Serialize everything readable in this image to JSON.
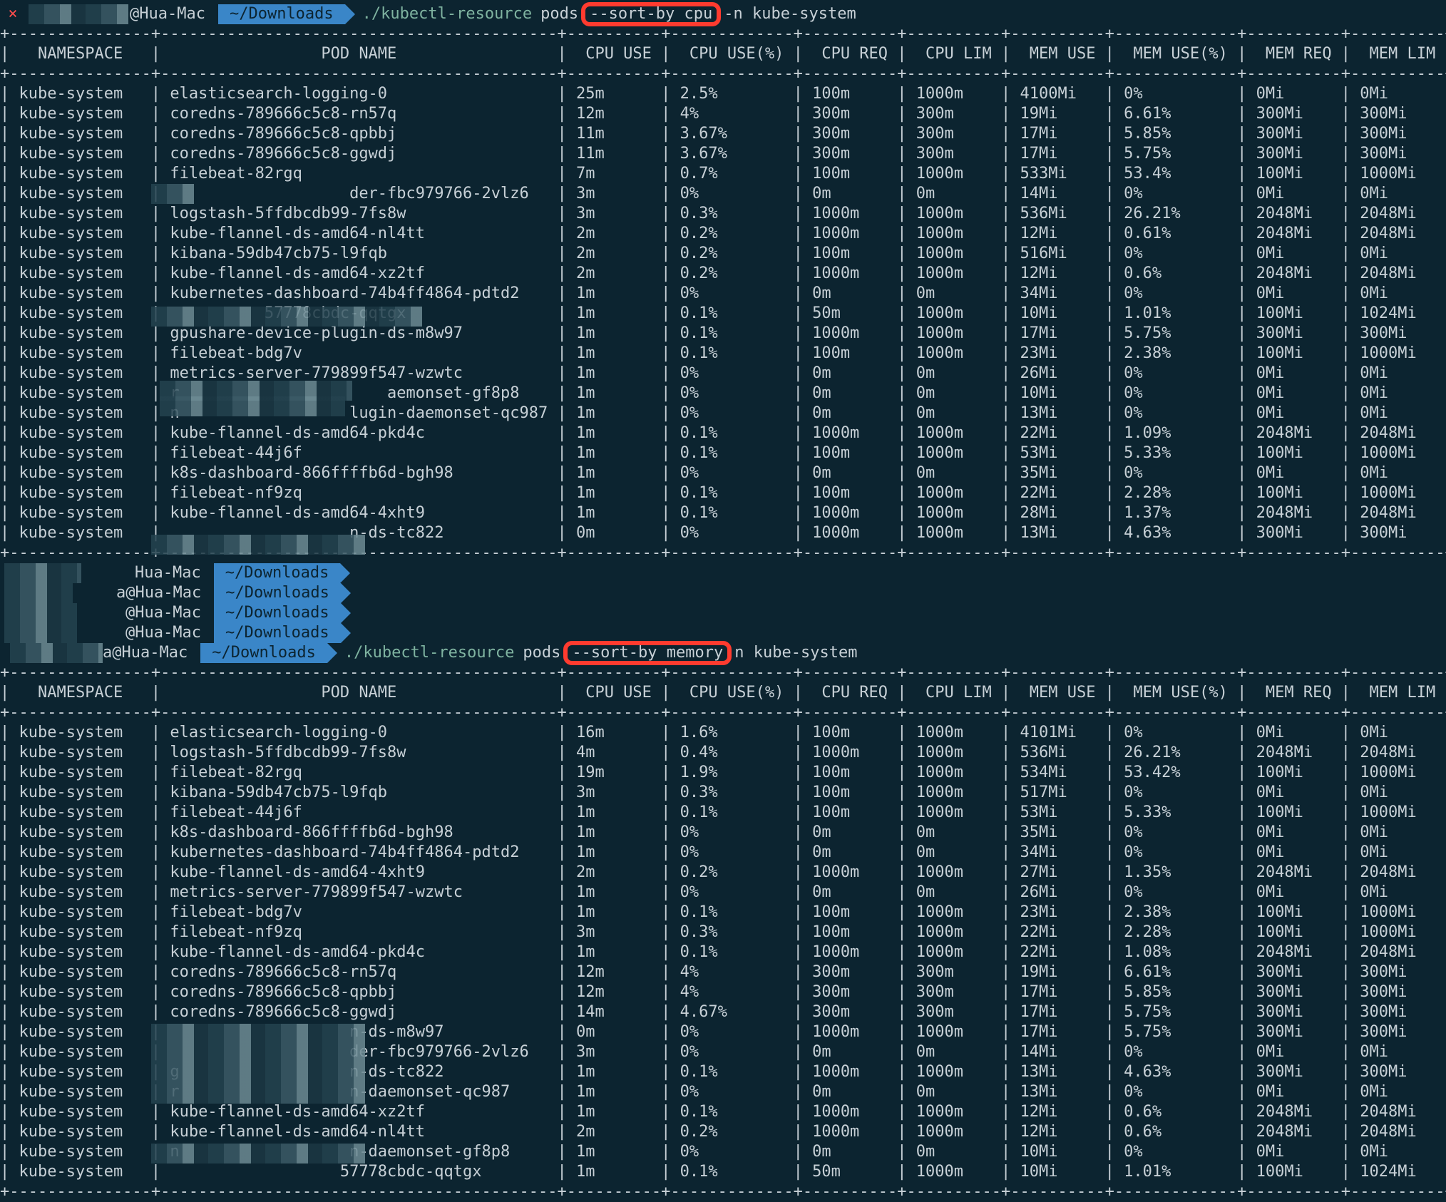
{
  "theme": {
    "background": "#0c2430",
    "path_segment": "#3a86c8",
    "highlight_box": "#ff3b2f",
    "error_mark": "#ff4d4d"
  },
  "prompt1": {
    "status_icon": "×",
    "user": "@Hua-Mac",
    "path": "~/Downloads",
    "command": "./kubectl-resource",
    "arg": "pods",
    "flag": "--sort-by cpu",
    "tail": "-n kube-system"
  },
  "columns": [
    "NAMESPACE",
    "POD NAME",
    "CPU USE",
    "CPU USE(%)",
    "CPU REQ",
    "CPU LIM",
    "MEM USE",
    "MEM USE(%)",
    "MEM REQ",
    "MEM LIM"
  ],
  "table1": [
    [
      "kube-system",
      "elasticsearch-logging-0",
      "25m",
      "2.5%",
      "100m",
      "1000m",
      "4100Mi",
      "0%",
      "0Mi",
      "0Mi"
    ],
    [
      "kube-system",
      "coredns-789666c5c8-rn57q",
      "12m",
      "4%",
      "300m",
      "300m",
      "19Mi",
      "6.61%",
      "300Mi",
      "300Mi"
    ],
    [
      "kube-system",
      "coredns-789666c5c8-qpbbj",
      "11m",
      "3.67%",
      "300m",
      "300m",
      "17Mi",
      "5.85%",
      "300Mi",
      "300Mi"
    ],
    [
      "kube-system",
      "coredns-789666c5c8-ggwdj",
      "11m",
      "3.67%",
      "300m",
      "300m",
      "17Mi",
      "5.75%",
      "300Mi",
      "300Mi"
    ],
    [
      "kube-system",
      "filebeat-82rgq",
      "7m",
      "0.7%",
      "100m",
      "1000m",
      "533Mi",
      "53.4%",
      "100Mi",
      "1000Mi"
    ],
    [
      "kube-system",
      "                   der-fbc979766-2vlz6",
      "3m",
      "0%",
      "0m",
      "0m",
      "14Mi",
      "0%",
      "0Mi",
      "0Mi"
    ],
    [
      "kube-system",
      "logstash-5ffdbcdb99-7fs8w",
      "3m",
      "0.3%",
      "1000m",
      "1000m",
      "536Mi",
      "26.21%",
      "2048Mi",
      "2048Mi"
    ],
    [
      "kube-system",
      "kube-flannel-ds-amd64-nl4tt",
      "2m",
      "0.2%",
      "1000m",
      "1000m",
      "12Mi",
      "0.61%",
      "2048Mi",
      "2048Mi"
    ],
    [
      "kube-system",
      "kibana-59db47cb75-l9fqb",
      "2m",
      "0.2%",
      "100m",
      "1000m",
      "516Mi",
      "0%",
      "0Mi",
      "0Mi"
    ],
    [
      "kube-system",
      "kube-flannel-ds-amd64-xz2tf",
      "2m",
      "0.2%",
      "1000m",
      "1000m",
      "12Mi",
      "0.6%",
      "2048Mi",
      "2048Mi"
    ],
    [
      "kube-system",
      "kubernetes-dashboard-74b4ff4864-pdtd2",
      "1m",
      "0%",
      "0m",
      "0m",
      "34Mi",
      "0%",
      "0Mi",
      "0Mi"
    ],
    [
      "kube-system",
      "          57778cbdc-qqtgx",
      "1m",
      "0.1%",
      "50m",
      "1000m",
      "10Mi",
      "1.01%",
      "100Mi",
      "1024Mi"
    ],
    [
      "kube-system",
      "gpushare-device-plugin-ds-m8w97",
      "1m",
      "0.1%",
      "1000m",
      "1000m",
      "17Mi",
      "5.75%",
      "300Mi",
      "300Mi"
    ],
    [
      "kube-system",
      "filebeat-bdg7v",
      "1m",
      "0.1%",
      "100m",
      "1000m",
      "23Mi",
      "2.38%",
      "100Mi",
      "1000Mi"
    ],
    [
      "kube-system",
      "metrics-server-779899f547-wzwtc",
      "1m",
      "0%",
      "0m",
      "0m",
      "26Mi",
      "0%",
      "0Mi",
      "0Mi"
    ],
    [
      "kube-system",
      "r                      aemonset-gf8p8",
      "1m",
      "0%",
      "0m",
      "0m",
      "10Mi",
      "0%",
      "0Mi",
      "0Mi"
    ],
    [
      "kube-system",
      "n                  lugin-daemonset-qc987",
      "1m",
      "0%",
      "0m",
      "0m",
      "13Mi",
      "0%",
      "0Mi",
      "0Mi"
    ],
    [
      "kube-system",
      "kube-flannel-ds-amd64-pkd4c",
      "1m",
      "0.1%",
      "1000m",
      "1000m",
      "22Mi",
      "1.09%",
      "2048Mi",
      "2048Mi"
    ],
    [
      "kube-system",
      "filebeat-44j6f",
      "1m",
      "0.1%",
      "100m",
      "1000m",
      "53Mi",
      "5.33%",
      "100Mi",
      "1000Mi"
    ],
    [
      "kube-system",
      "k8s-dashboard-866ffffb6d-bgh98",
      "1m",
      "0%",
      "0m",
      "0m",
      "35Mi",
      "0%",
      "0Mi",
      "0Mi"
    ],
    [
      "kube-system",
      "filebeat-nf9zq",
      "1m",
      "0.1%",
      "100m",
      "1000m",
      "22Mi",
      "2.28%",
      "100Mi",
      "1000Mi"
    ],
    [
      "kube-system",
      "kube-flannel-ds-amd64-4xht9",
      "1m",
      "0.1%",
      "1000m",
      "1000m",
      "28Mi",
      "1.37%",
      "2048Mi",
      "2048Mi"
    ],
    [
      "kube-system",
      "                   n-ds-tc822",
      "0m",
      "0%",
      "1000m",
      "1000m",
      "13Mi",
      "4.63%",
      "300Mi",
      "300Mi"
    ]
  ],
  "history": [
    {
      "user": "Hua-Mac",
      "path": "~/Downloads"
    },
    {
      "user": "a@Hua-Mac",
      "path": "~/Downloads"
    },
    {
      "user": "@Hua-Mac",
      "path": "~/Downloads"
    },
    {
      "user": "@Hua-Mac",
      "path": "~/Downloads"
    }
  ],
  "prompt2": {
    "user": "a@Hua-Mac",
    "path": "~/Downloads",
    "command": "./kubectl-resource",
    "arg": "pods",
    "flag": "--sort-by memory",
    "tail": "n kube-system"
  },
  "table2": [
    [
      "kube-system",
      "elasticsearch-logging-0",
      "16m",
      "1.6%",
      "100m",
      "1000m",
      "4101Mi",
      "0%",
      "0Mi",
      "0Mi"
    ],
    [
      "kube-system",
      "logstash-5ffdbcdb99-7fs8w",
      "4m",
      "0.4%",
      "1000m",
      "1000m",
      "536Mi",
      "26.21%",
      "2048Mi",
      "2048Mi"
    ],
    [
      "kube-system",
      "filebeat-82rgq",
      "19m",
      "1.9%",
      "100m",
      "1000m",
      "534Mi",
      "53.42%",
      "100Mi",
      "1000Mi"
    ],
    [
      "kube-system",
      "kibana-59db47cb75-l9fqb",
      "3m",
      "0.3%",
      "100m",
      "1000m",
      "517Mi",
      "0%",
      "0Mi",
      "0Mi"
    ],
    [
      "kube-system",
      "filebeat-44j6f",
      "1m",
      "0.1%",
      "100m",
      "1000m",
      "53Mi",
      "5.33%",
      "100Mi",
      "1000Mi"
    ],
    [
      "kube-system",
      "k8s-dashboard-866ffffb6d-bgh98",
      "1m",
      "0%",
      "0m",
      "0m",
      "35Mi",
      "0%",
      "0Mi",
      "0Mi"
    ],
    [
      "kube-system",
      "kubernetes-dashboard-74b4ff4864-pdtd2",
      "1m",
      "0%",
      "0m",
      "0m",
      "34Mi",
      "0%",
      "0Mi",
      "0Mi"
    ],
    [
      "kube-system",
      "kube-flannel-ds-amd64-4xht9",
      "2m",
      "0.2%",
      "1000m",
      "1000m",
      "27Mi",
      "1.35%",
      "2048Mi",
      "2048Mi"
    ],
    [
      "kube-system",
      "metrics-server-779899f547-wzwtc",
      "1m",
      "0%",
      "0m",
      "0m",
      "26Mi",
      "0%",
      "0Mi",
      "0Mi"
    ],
    [
      "kube-system",
      "filebeat-bdg7v",
      "1m",
      "0.1%",
      "100m",
      "1000m",
      "23Mi",
      "2.38%",
      "100Mi",
      "1000Mi"
    ],
    [
      "kube-system",
      "filebeat-nf9zq",
      "3m",
      "0.3%",
      "100m",
      "1000m",
      "22Mi",
      "2.28%",
      "100Mi",
      "1000Mi"
    ],
    [
      "kube-system",
      "kube-flannel-ds-amd64-pkd4c",
      "1m",
      "0.1%",
      "1000m",
      "1000m",
      "22Mi",
      "1.08%",
      "2048Mi",
      "2048Mi"
    ],
    [
      "kube-system",
      "coredns-789666c5c8-rn57q",
      "12m",
      "4%",
      "300m",
      "300m",
      "19Mi",
      "6.61%",
      "300Mi",
      "300Mi"
    ],
    [
      "kube-system",
      "coredns-789666c5c8-qpbbj",
      "12m",
      "4%",
      "300m",
      "300m",
      "17Mi",
      "5.85%",
      "300Mi",
      "300Mi"
    ],
    [
      "kube-system",
      "coredns-789666c5c8-ggwdj",
      "14m",
      "4.67%",
      "300m",
      "300m",
      "17Mi",
      "5.75%",
      "300Mi",
      "300Mi"
    ],
    [
      "kube-system",
      "                   n-ds-m8w97",
      "0m",
      "0%",
      "1000m",
      "1000m",
      "17Mi",
      "5.75%",
      "300Mi",
      "300Mi"
    ],
    [
      "kube-system",
      "                   der-fbc979766-2vlz6",
      "3m",
      "0%",
      "0m",
      "0m",
      "14Mi",
      "0%",
      "0Mi",
      "0Mi"
    ],
    [
      "kube-system",
      "g                  n-ds-tc822",
      "1m",
      "0.1%",
      "1000m",
      "1000m",
      "13Mi",
      "4.63%",
      "300Mi",
      "300Mi"
    ],
    [
      "kube-system",
      "r                  n-daemonset-qc987",
      "1m",
      "0%",
      "0m",
      "0m",
      "13Mi",
      "0%",
      "0Mi",
      "0Mi"
    ],
    [
      "kube-system",
      "kube-flannel-ds-amd64-xz2tf",
      "1m",
      "0.1%",
      "1000m",
      "1000m",
      "12Mi",
      "0.6%",
      "2048Mi",
      "2048Mi"
    ],
    [
      "kube-system",
      "kube-flannel-ds-amd64-nl4tt",
      "2m",
      "0.2%",
      "1000m",
      "1000m",
      "12Mi",
      "0.6%",
      "2048Mi",
      "2048Mi"
    ],
    [
      "kube-system",
      "n                  n-daemonset-gf8p8",
      "1m",
      "0%",
      "0m",
      "0m",
      "10Mi",
      "0%",
      "0Mi",
      "0Mi"
    ],
    [
      "kube-system",
      "                  57778cbdc-qqtgx",
      "1m",
      "0.1%",
      "50m",
      "1000m",
      "10Mi",
      "1.01%",
      "100Mi",
      "1024Mi"
    ]
  ]
}
